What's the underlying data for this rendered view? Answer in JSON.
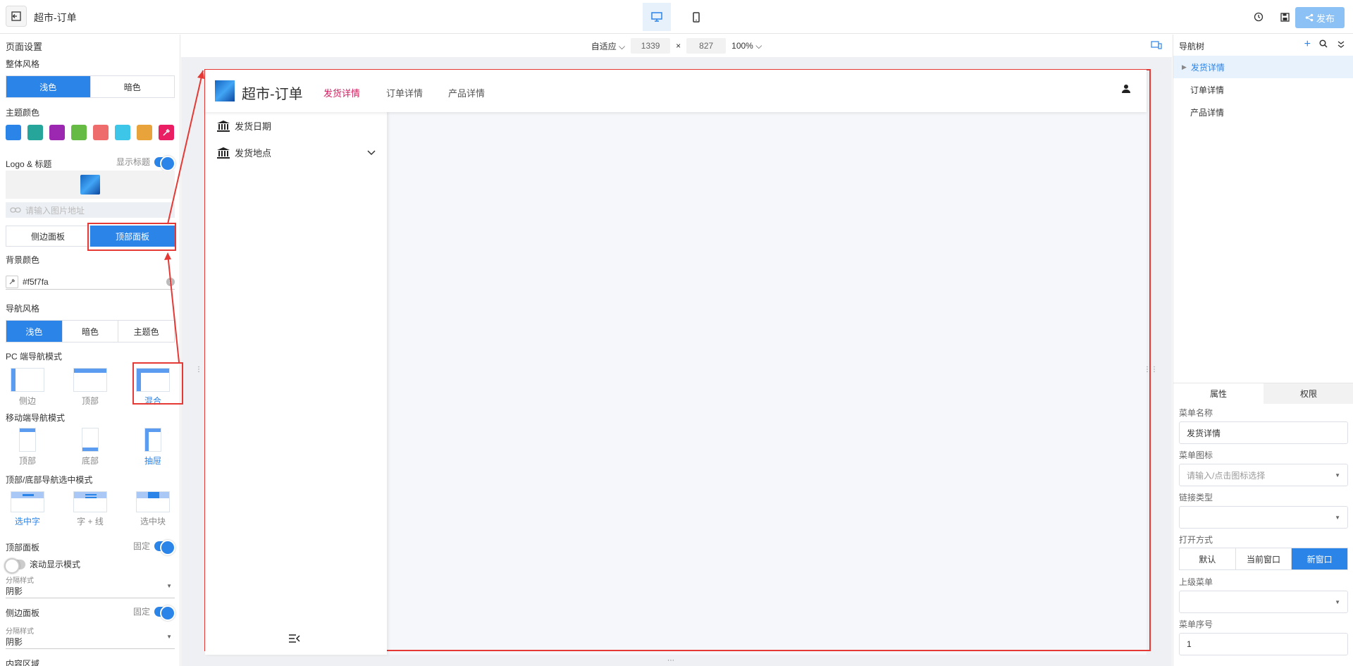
{
  "app": {
    "title": "超市-订单"
  },
  "toolbar": {
    "adapt_label": "自适应",
    "width": "1339",
    "times": "×",
    "height": "827",
    "zoom": "100%",
    "publish_label": "发布"
  },
  "left": {
    "page_settings": "页面设置",
    "overall_style": "整体风格",
    "style_options": [
      "浅色",
      "暗色"
    ],
    "theme_color": "主题颜色",
    "swatches": [
      "#2b84e8",
      "#26a69a",
      "#9c27b0",
      "#66bb44",
      "#ef6c6c",
      "#3ec6e8",
      "#e8a33a"
    ],
    "picker_color": "#e91e63",
    "logo_title": "Logo & 标题",
    "show_title": "显示标题",
    "url_placeholder": "请输入图片地址",
    "side_panel": "侧边面板",
    "top_panel": "顶部面板",
    "bg_color": "背景颜色",
    "bg_value": "#f5f7fa",
    "nav_style": "导航风格",
    "nav_options": [
      "浅色",
      "暗色",
      "主题色"
    ],
    "pc_nav_mode": "PC 端导航模式",
    "pc_modes": [
      "侧边",
      "顶部",
      "混合"
    ],
    "mobile_nav_mode": "移动端导航模式",
    "mobile_modes": [
      "顶部",
      "底部",
      "抽屉"
    ],
    "select_mode": "顶部/底部导航选中模式",
    "select_modes": [
      "选中字",
      "字 + 线",
      "选中块"
    ],
    "top_panel_label": "顶部面板",
    "fixed": "固定",
    "scroll_mode": "滚动显示模式",
    "divider_style": "分隔样式",
    "shadow": "阴影",
    "side_panel_label": "侧边面板",
    "content_area": "内容区域"
  },
  "preview": {
    "title": "超市-订单",
    "nav": [
      "发货详情",
      "订单详情",
      "产品详情"
    ],
    "side_items": [
      "发货日期",
      "发货地点"
    ]
  },
  "right": {
    "nav_tree": "导航树",
    "tree": [
      "发货详情",
      "订单详情",
      "产品详情"
    ],
    "tabs": [
      "属性",
      "权限"
    ],
    "menu_name_label": "菜单名称",
    "menu_name": "发货详情",
    "menu_icon_label": "菜单图标",
    "menu_icon_placeholder": "请输入/点击图标选择",
    "link_type_label": "链接类型",
    "open_mode_label": "打开方式",
    "open_modes": [
      "默认",
      "当前窗口",
      "新窗口"
    ],
    "parent_menu_label": "上级菜单",
    "menu_order_label": "菜单序号",
    "menu_order": "1"
  }
}
